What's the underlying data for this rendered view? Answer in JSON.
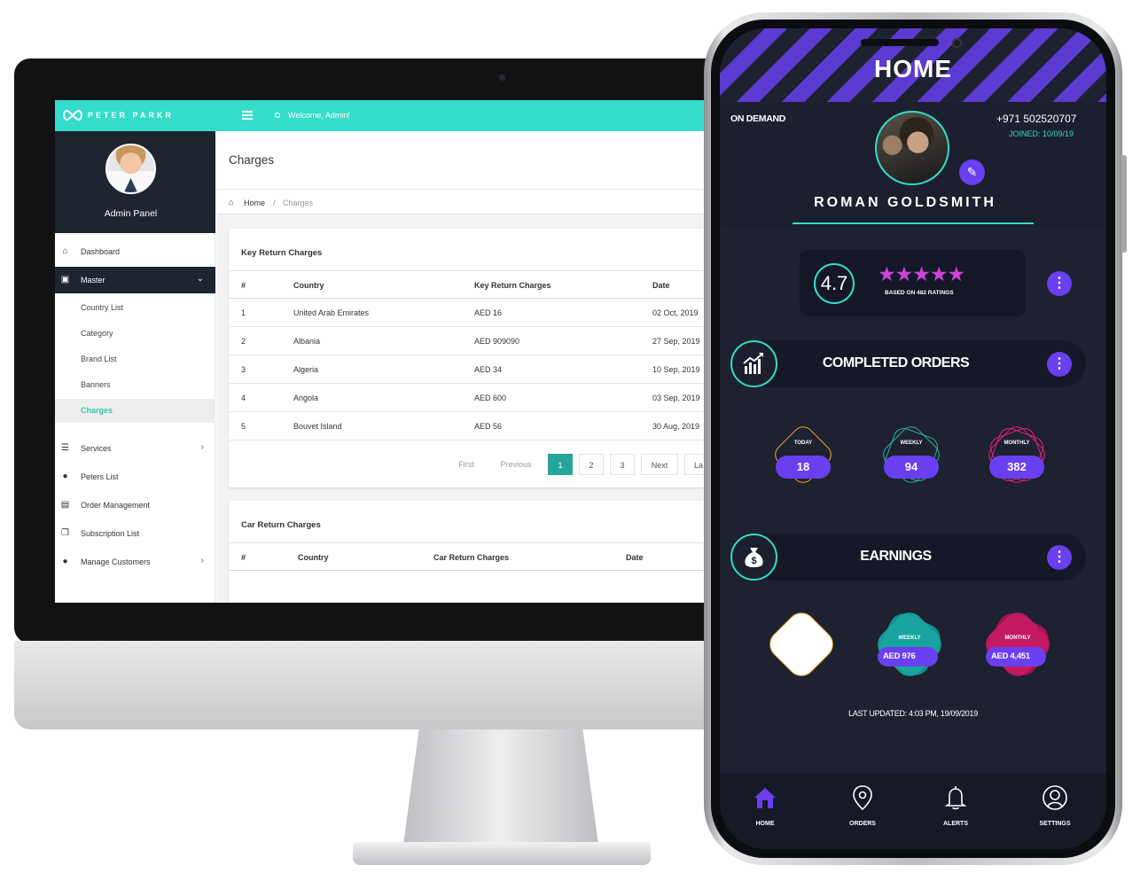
{
  "admin": {
    "brand": "PETER PARKR",
    "welcome": "Welcome, Admin!",
    "profile_label": "Admin Panel",
    "nav": [
      {
        "label": "Dashboard",
        "icon": "home-icon"
      },
      {
        "label": "Master",
        "icon": "clipboard-icon"
      },
      {
        "label": "Services",
        "icon": "list-icon"
      },
      {
        "label": "Peters List",
        "icon": "user-icon"
      },
      {
        "label": "Order Management",
        "icon": "card-icon"
      },
      {
        "label": "Subscription List",
        "icon": "copy-icon"
      },
      {
        "label": "Manage Customers",
        "icon": "user-edit-icon"
      }
    ],
    "master_sub": [
      "Country List",
      "Category",
      "Brand List",
      "Banners",
      "Charges"
    ],
    "page_title": "Charges",
    "breadcrumb": {
      "home": "Home",
      "sep": "/",
      "current": "Charges"
    },
    "key_card": {
      "title": "Key Return Charges",
      "headers": [
        "#",
        "Country",
        "Key Return Charges",
        "Date"
      ],
      "rows": [
        [
          "1",
          "United Arab Emirates",
          "AED 16",
          "02 Oct, 2019"
        ],
        [
          "2",
          "Albania",
          "AED 909090",
          "27 Sep, 2019"
        ],
        [
          "3",
          "Algeria",
          "AED 34",
          "10 Sep, 2019"
        ],
        [
          "4",
          "Angola",
          "AED 600",
          "03 Sep, 2019"
        ],
        [
          "5",
          "Bouvet Island",
          "AED 56",
          "30 Aug, 2019"
        ]
      ],
      "pagination": [
        "First",
        "Previous",
        "1",
        "2",
        "3",
        "Next",
        "La"
      ]
    },
    "car_card": {
      "title": "Car Return Charges",
      "headers": [
        "#",
        "Country",
        "Car Return Charges",
        "Date"
      ]
    }
  },
  "mobile": {
    "title": "HOME",
    "mode": "ON DEMAND",
    "phone": "+971 502520707",
    "joined": "JOINED: 10/09/19",
    "name": "ROMAN GOLDSMITH",
    "rating": "4.7",
    "stars": "★★★★★",
    "rating_caption": "BASED ON 482 RATINGS",
    "completed_title": "COMPLETED ORDERS",
    "orders": [
      {
        "label": "TODAY",
        "value": "18"
      },
      {
        "label": "WEEKLY",
        "value": "94"
      },
      {
        "label": "MONTHLY",
        "value": "382"
      }
    ],
    "earnings_title": "EARNINGS",
    "earnings": [
      {
        "label": "WEEKLY",
        "value": "AED 976"
      },
      {
        "label": "MONTHLY",
        "value": "AED 4,451"
      }
    ],
    "last_updated": "LAST UPDATED: 4:03 PM, 19/09/2019",
    "tabs": [
      "HOME",
      "ORDERS",
      "ALERTS",
      "SETTINGS"
    ],
    "colors": {
      "accent": "#6a3ff0",
      "teal": "#33ddc9",
      "magenta": "#e0247a",
      "orange": "#f0a830"
    }
  }
}
